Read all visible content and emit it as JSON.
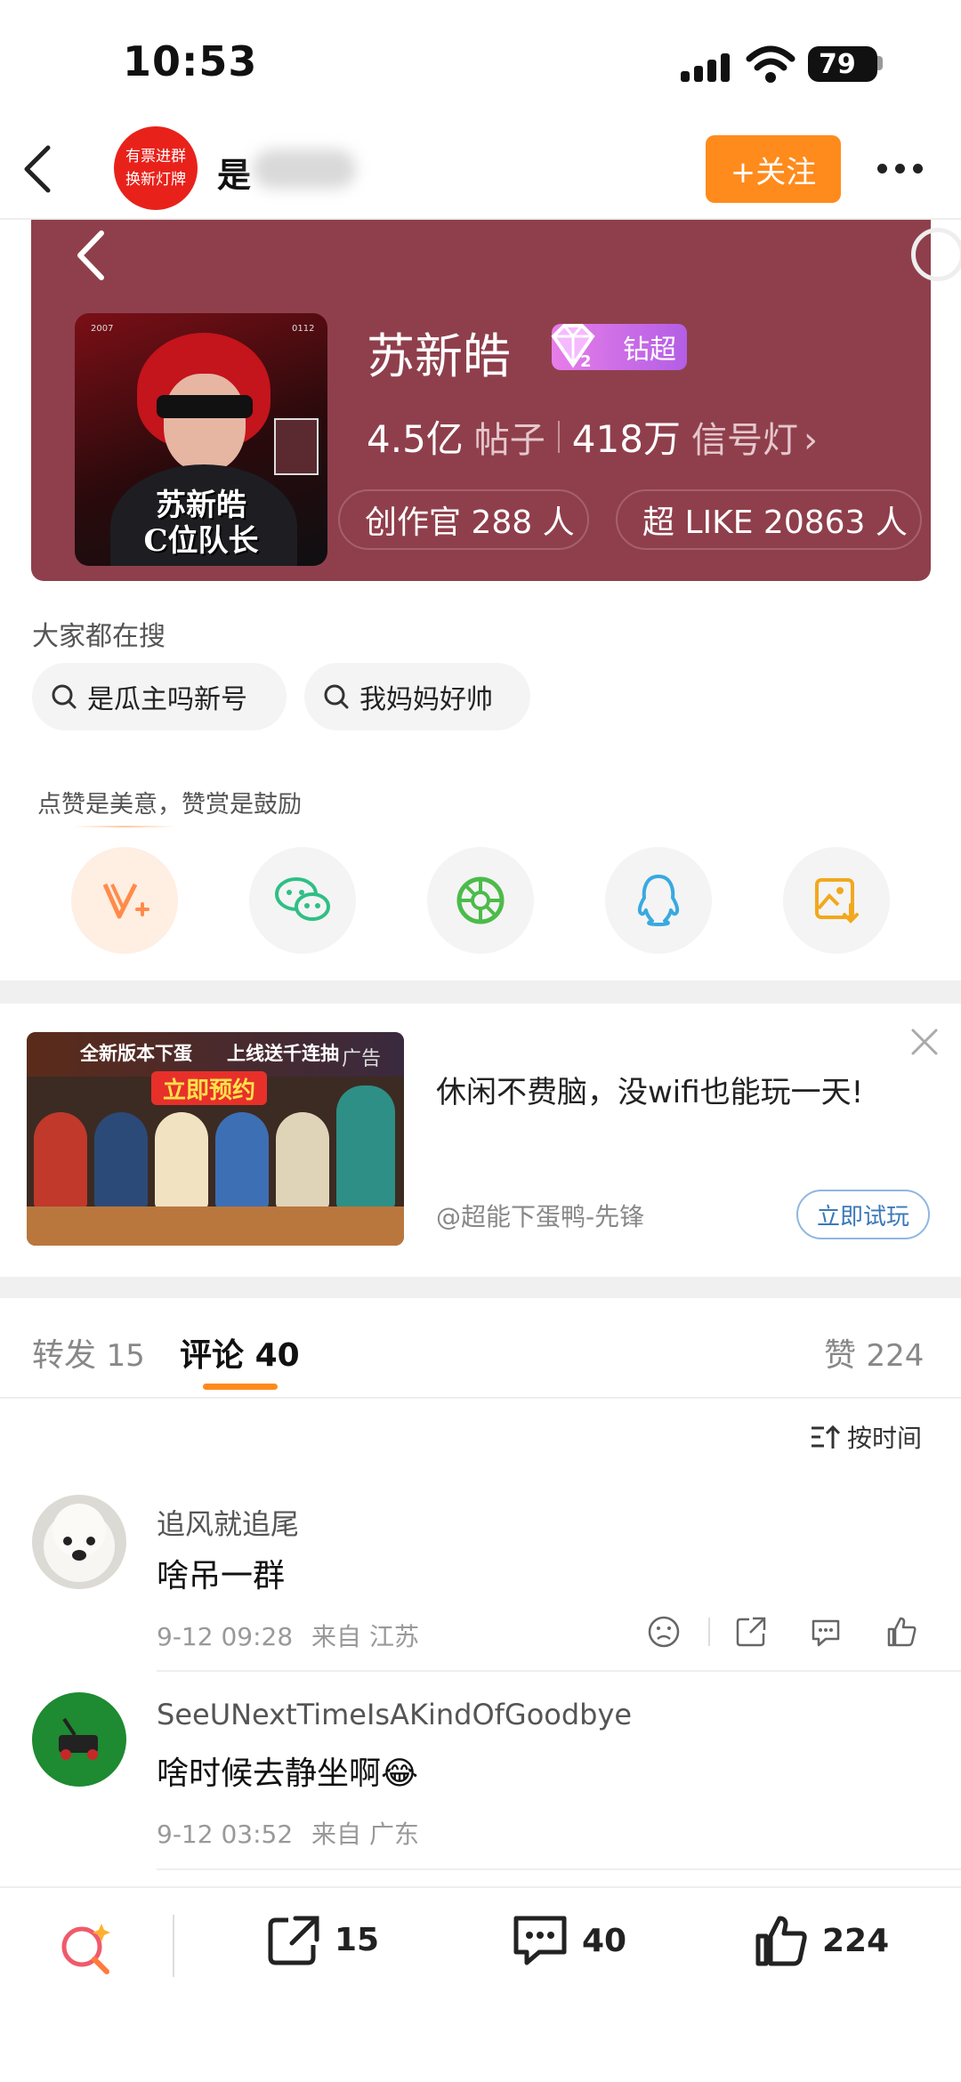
{
  "status": {
    "time": "10:53",
    "battery": "79"
  },
  "nav": {
    "avatar_text_1": "有票进群",
    "avatar_text_2": "换新灯牌",
    "name_visible": "是",
    "follow_label": "+关注"
  },
  "topic": {
    "name": "苏新皓",
    "badge": "钻超",
    "posts_count": "4.5亿",
    "posts_label": "帖子",
    "signal_count": "418万",
    "signal_label": "信号灯",
    "creator_chip": "创作官 288 人",
    "like_chip": "超 LIKE 20863 人",
    "cover_text": "苏新皓\nC位队长",
    "cover_num_left": "2007",
    "cover_num_right": "0112"
  },
  "hot_search": {
    "title": "大家都在搜",
    "items": [
      "是瓜主吗新号",
      "我妈妈好帅"
    ]
  },
  "share": {
    "tip": "点赞是美意，赞赏是鼓励",
    "icons": [
      "reward-v-icon",
      "wechat-icon",
      "moments-icon",
      "qq-icon",
      "save-image-icon"
    ]
  },
  "ad": {
    "title": "休闲不费脑，没wifi也能玩一天!",
    "source": "@超能下蛋鸭-先锋",
    "button": "立即试玩",
    "image_banner": "全新版本下蛋",
    "image_banner_2": "上线送千连抽",
    "image_label": "广告",
    "image_cta": "立即预约"
  },
  "tabs": {
    "repost_label": "转发",
    "repost_count": "15",
    "comment_label": "评论",
    "comment_count": "40",
    "like_label": "赞",
    "like_count": "224"
  },
  "sort_label": "按时间",
  "comments": [
    {
      "name": "追风就追尾",
      "text": "啥吊一群",
      "time": "9-12 09:28",
      "location": "来自 江苏"
    },
    {
      "name": "SeeUNextTimeIsAKindOfGoodbye",
      "text": "啥时候去静坐啊😂",
      "time": "9-12 03:52",
      "location": "来自 广东"
    }
  ],
  "bottom_bar": {
    "repost_count": "15",
    "comment_count": "40",
    "like_count": "224"
  },
  "colors": {
    "accent": "#ff8b1d",
    "topic_bg": "#8f3f4c",
    "badge": "#c76be6"
  }
}
